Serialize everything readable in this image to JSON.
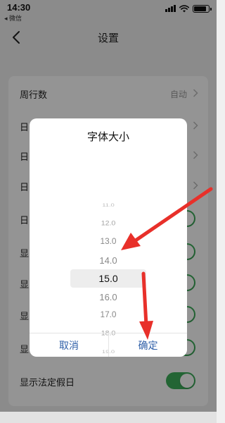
{
  "status_bar": {
    "time": "14:30",
    "back_app": "◂ 微信",
    "battery_level": 0.85
  },
  "nav": {
    "title": "设置",
    "back_icon": "chevron-left-icon"
  },
  "settings": [
    {
      "label": "周行数",
      "value": "自动",
      "control": "chevron"
    },
    {
      "label": "日",
      "value": "",
      "control": "chevron"
    },
    {
      "label": "日",
      "value": "",
      "control": "chevron"
    },
    {
      "label": "日",
      "value": "",
      "control": "chevron"
    },
    {
      "label": "日",
      "value": "",
      "control": "toggle",
      "on": true
    },
    {
      "label": "显",
      "value": "",
      "control": "toggle",
      "on": true
    },
    {
      "label": "显",
      "value": "",
      "control": "toggle",
      "on": true
    },
    {
      "label": "显",
      "value": "",
      "control": "toggle",
      "on": true
    },
    {
      "label": "显",
      "value": "",
      "control": "toggle",
      "on": true
    },
    {
      "label": "显示法定假日",
      "value": "",
      "control": "toggle",
      "on": true
    }
  ],
  "dialog": {
    "title": "字体大小",
    "options": [
      "11.0",
      "12.0",
      "13.0",
      "14.0",
      "15.0",
      "16.0",
      "17.0",
      "18.0",
      "19.0"
    ],
    "selected": "15.0",
    "cancel_label": "取消",
    "confirm_label": "确定"
  },
  "colors": {
    "toggle_on": "#3dae5b",
    "button_text": "#2f5fa8",
    "arrow": "#e8302a"
  }
}
